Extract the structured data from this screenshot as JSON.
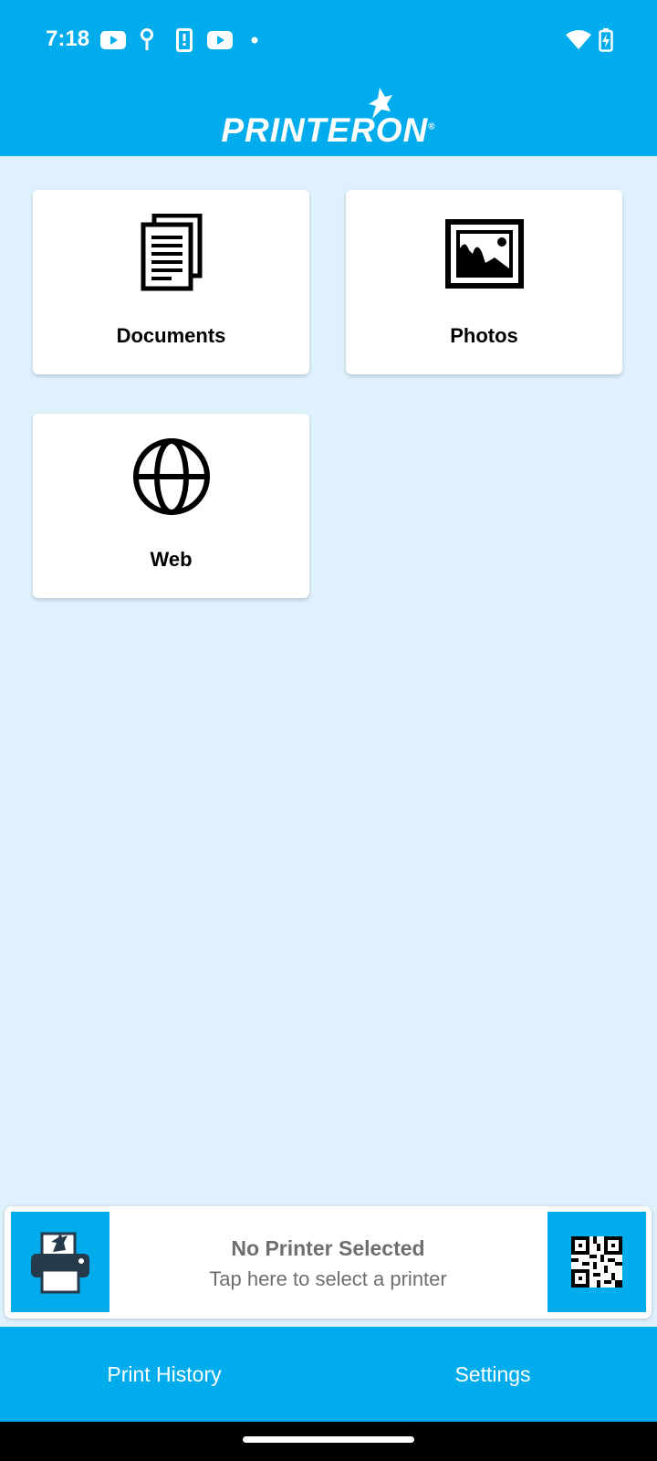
{
  "status_bar": {
    "time": "7:18",
    "left_icons": [
      "youtube-icon",
      "hearing-icon",
      "phone-alert-icon",
      "youtube-icon",
      "dot-icon"
    ],
    "right_icons": [
      "wifi-icon",
      "battery-charging-icon"
    ]
  },
  "app": {
    "logo_text": "PRINTERON",
    "logo_mark": "®",
    "colors": {
      "brand": "#00ACEC",
      "background": "#DFF1FC"
    }
  },
  "tiles": [
    {
      "label": "Documents",
      "icon": "documents-icon"
    },
    {
      "label": "Photos",
      "icon": "photos-icon"
    },
    {
      "label": "Web",
      "icon": "globe-icon"
    }
  ],
  "printer_bar": {
    "title": "No Printer Selected",
    "subtitle": "Tap here to select a printer",
    "left_icon": "printer-icon",
    "right_icon": "qr-code-icon"
  },
  "bottom_nav": {
    "items": [
      {
        "label": "Print History"
      },
      {
        "label": "Settings"
      }
    ]
  }
}
